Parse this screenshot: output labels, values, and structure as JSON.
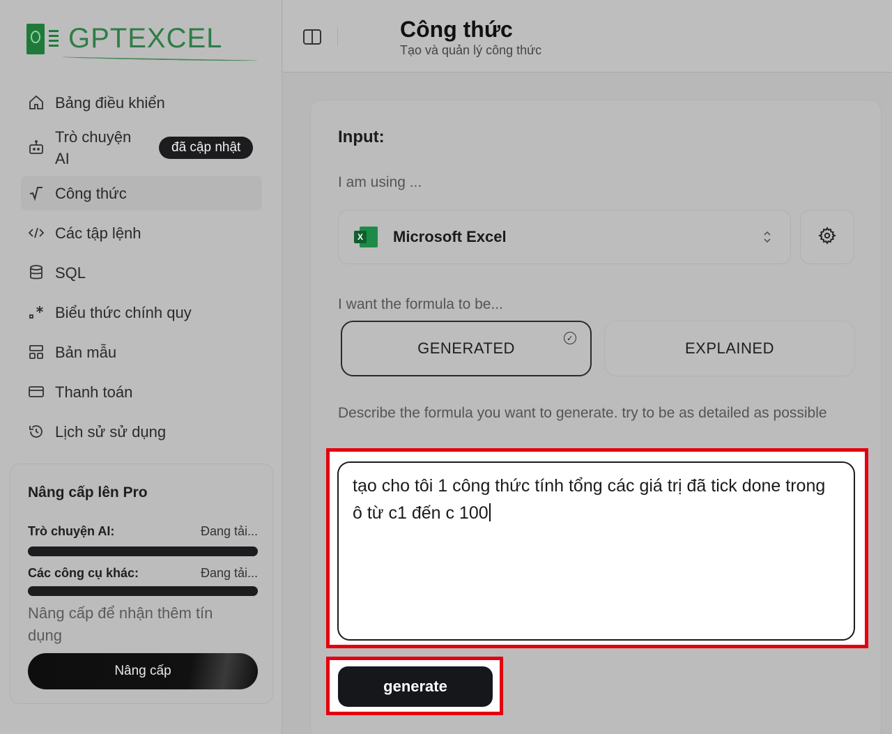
{
  "app": {
    "logo_text": "GPTEXCEL"
  },
  "sidebar": {
    "items": [
      {
        "label": "Bảng điều khiển",
        "icon": "home-icon"
      },
      {
        "label": "Trò chuyện AI",
        "icon": "bot-icon",
        "badge": "đã cập nhật"
      },
      {
        "label": "Công thức",
        "icon": "square-root-icon",
        "active": true
      },
      {
        "label": "Các tập lệnh",
        "icon": "code-icon"
      },
      {
        "label": "SQL",
        "icon": "database-icon"
      },
      {
        "label": "Biểu thức chính quy",
        "icon": "regex-icon"
      },
      {
        "label": "Bản mẫu",
        "icon": "template-icon"
      },
      {
        "label": "Thanh toán",
        "icon": "credit-card-icon"
      },
      {
        "label": "Lịch sử sử dụng",
        "icon": "history-icon"
      }
    ]
  },
  "pro": {
    "title": "Nâng cấp lên Pro",
    "chat_label": "Trò chuyện AI:",
    "chat_value": "Đang tải...",
    "chat_progress": 1.0,
    "tools_label": "Các công cụ khác:",
    "tools_value": "Đang tải...",
    "tools_progress": 1.0,
    "note": "Nâng cấp để nhận thêm tín dụng",
    "button": "Nâng cấp"
  },
  "header": {
    "title": "Công thức",
    "subtitle": "Tạo và quản lý công thức"
  },
  "form": {
    "input_label": "Input:",
    "using_label": "I am using ...",
    "app_selected": "Microsoft Excel",
    "want_label": "I want the formula to be...",
    "option_generated": "GENERATED",
    "option_explained": "EXPLAINED",
    "describe_label": "Describe the formula you want to generate. try to be as detailed as possible",
    "prompt_text": "tạo cho tôi 1 công thức tính tổng các giá trị đã tick done trong ô từ c1 đến c 100",
    "generate_button": "generate"
  },
  "colors": {
    "highlight": "#e3000f",
    "brand_green": "#2e7d46",
    "button_dark": "#16171b"
  }
}
